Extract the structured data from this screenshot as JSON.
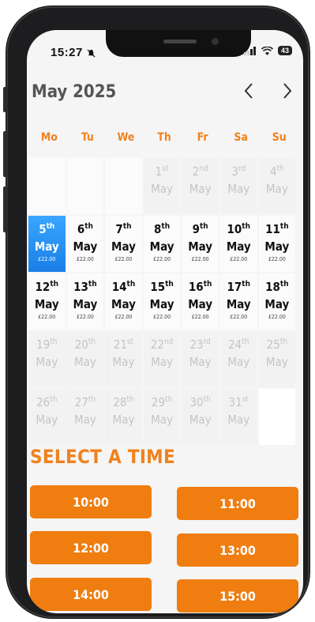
{
  "status": {
    "time": "15:27",
    "battery": "43"
  },
  "calendar": {
    "month_title": "May 2025",
    "prev_label": "<",
    "next_label": ">",
    "weekdays": [
      "Mo",
      "Tu",
      "We",
      "Th",
      "Fr",
      "Sa",
      "Su"
    ],
    "weeks": [
      [
        {
          "blank": true
        },
        {
          "blank": true
        },
        {
          "blank": true
        },
        {
          "day": "1",
          "suffix": "st",
          "month": "May",
          "disabled": true
        },
        {
          "day": "2",
          "suffix": "nd",
          "month": "May",
          "disabled": true
        },
        {
          "day": "3",
          "suffix": "rd",
          "month": "May",
          "disabled": true
        },
        {
          "day": "4",
          "suffix": "th",
          "month": "May",
          "disabled": true
        }
      ],
      [
        {
          "day": "5",
          "suffix": "th",
          "month": "May",
          "price": "£22.00",
          "selected": true
        },
        {
          "day": "6",
          "suffix": "th",
          "month": "May",
          "price": "£22.00"
        },
        {
          "day": "7",
          "suffix": "th",
          "month": "May",
          "price": "£22.00"
        },
        {
          "day": "8",
          "suffix": "th",
          "month": "May",
          "price": "£22.00"
        },
        {
          "day": "9",
          "suffix": "th",
          "month": "May",
          "price": "£22.00"
        },
        {
          "day": "10",
          "suffix": "th",
          "month": "May",
          "price": "£22.00"
        },
        {
          "day": "11",
          "suffix": "th",
          "month": "May",
          "price": "£22.00"
        }
      ],
      [
        {
          "day": "12",
          "suffix": "th",
          "month": "May",
          "price": "£22.00"
        },
        {
          "day": "13",
          "suffix": "th",
          "month": "May",
          "price": "£22.00"
        },
        {
          "day": "14",
          "suffix": "th",
          "month": "May",
          "price": "£22.00"
        },
        {
          "day": "15",
          "suffix": "th",
          "month": "May",
          "price": "£22.00"
        },
        {
          "day": "16",
          "suffix": "th",
          "month": "May",
          "price": "£22.00"
        },
        {
          "day": "17",
          "suffix": "th",
          "month": "May",
          "price": "£22.00"
        },
        {
          "day": "18",
          "suffix": "th",
          "month": "May",
          "price": "£22.00"
        }
      ],
      [
        {
          "day": "19",
          "suffix": "th",
          "month": "May",
          "disabled": true
        },
        {
          "day": "20",
          "suffix": "th",
          "month": "May",
          "disabled": true
        },
        {
          "day": "21",
          "suffix": "st",
          "month": "May",
          "disabled": true
        },
        {
          "day": "22",
          "suffix": "nd",
          "month": "May",
          "disabled": true
        },
        {
          "day": "23",
          "suffix": "rd",
          "month": "May",
          "disabled": true
        },
        {
          "day": "24",
          "suffix": "th",
          "month": "May",
          "disabled": true
        },
        {
          "day": "25",
          "suffix": "th",
          "month": "May",
          "disabled": true
        }
      ],
      [
        {
          "day": "26",
          "suffix": "th",
          "month": "May",
          "disabled": true
        },
        {
          "day": "27",
          "suffix": "th",
          "month": "May",
          "disabled": true
        },
        {
          "day": "28",
          "suffix": "th",
          "month": "May",
          "disabled": true
        },
        {
          "day": "29",
          "suffix": "th",
          "month": "May",
          "disabled": true
        },
        {
          "day": "30",
          "suffix": "th",
          "month": "May",
          "disabled": true
        },
        {
          "day": "31",
          "suffix": "st",
          "month": "May",
          "disabled": true
        },
        {
          "blank": true,
          "white": true
        }
      ]
    ]
  },
  "times": {
    "title": "SELECT A TIME",
    "slots": [
      "10:00",
      "11:00",
      "12:00",
      "13:00",
      "14:00",
      "15:00"
    ]
  },
  "colors": {
    "accent": "#ef7d10",
    "selected": "#1a7fe6"
  },
  "icons": [
    "bell-slash-icon",
    "signal-icon",
    "wifi-icon",
    "battery-icon",
    "chevron-left-icon",
    "chevron-right-icon"
  ]
}
